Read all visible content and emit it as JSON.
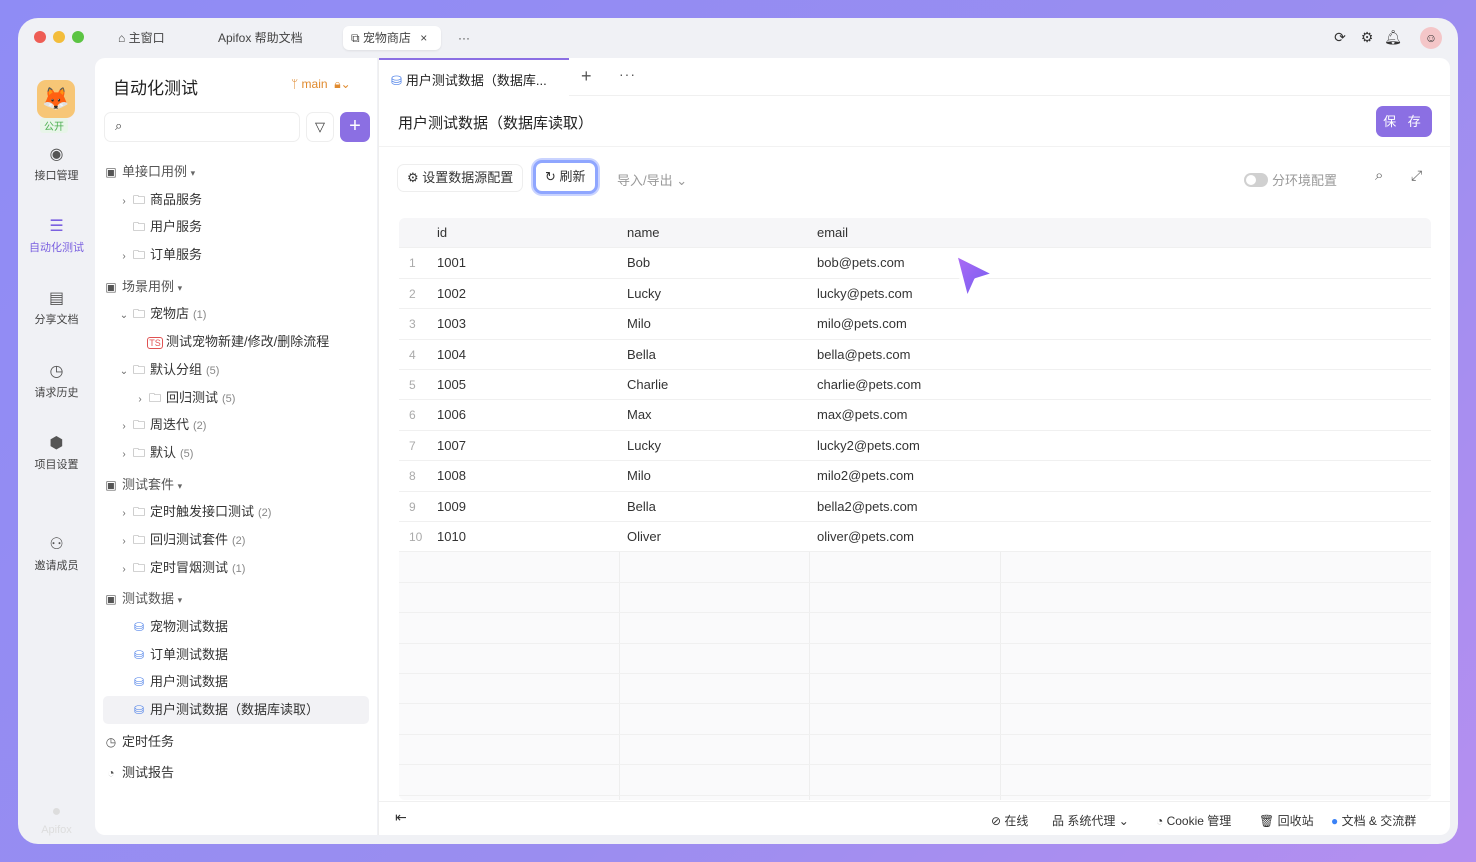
{
  "titlebar": {
    "tabs": [
      {
        "label": "主窗口",
        "icon": "home-icon"
      },
      {
        "label": "Apifox 帮助文档"
      },
      {
        "label": "宠物商店",
        "icon": "external-icon",
        "close": "×"
      }
    ],
    "more": "···"
  },
  "rail": {
    "badge": "公开",
    "items": [
      {
        "label": "接口管理"
      },
      {
        "label": "自动化测试"
      },
      {
        "label": "分享文档"
      },
      {
        "label": "请求历史"
      },
      {
        "label": "项目设置"
      },
      {
        "label": "邀请成员"
      }
    ],
    "brand": "Apifox"
  },
  "sidebar": {
    "title": "自动化测试",
    "branch": "main",
    "add": "+",
    "tree": [
      {
        "label": "单接口用例",
        "level": 0,
        "type": "section",
        "arrow": "▾"
      },
      {
        "label": "商品服务",
        "level": 1,
        "type": "folder",
        "arrow": "›"
      },
      {
        "label": "用户服务",
        "level": 1,
        "type": "folder"
      },
      {
        "label": "订单服务",
        "level": 1,
        "type": "folder",
        "arrow": "›"
      },
      {
        "label": "场景用例",
        "level": 0,
        "type": "section",
        "arrow": "▾"
      },
      {
        "label": "宠物店",
        "count": "(1)",
        "level": 1,
        "type": "folder",
        "arrow": "⌄"
      },
      {
        "label": "测试宠物新建/修改/删除流程",
        "level": 2,
        "type": "ts"
      },
      {
        "label": "默认分组",
        "count": "(5)",
        "level": 1,
        "type": "folder",
        "arrow": "⌄"
      },
      {
        "label": "回归测试",
        "count": "(5)",
        "level": 2,
        "type": "folder",
        "arrow": "›"
      },
      {
        "label": "周迭代",
        "count": "(2)",
        "level": 1,
        "type": "folder",
        "arrow": "›"
      },
      {
        "label": "默认",
        "count": "(5)",
        "level": 1,
        "type": "folder",
        "arrow": "›"
      },
      {
        "label": "测试套件",
        "level": 0,
        "type": "section",
        "arrow": "▾"
      },
      {
        "label": "定时触发接口测试",
        "count": "(2)",
        "level": 1,
        "type": "folder",
        "arrow": "›"
      },
      {
        "label": "回归测试套件",
        "count": "(2)",
        "level": 1,
        "type": "folder",
        "arrow": "›"
      },
      {
        "label": "定时冒烟测试",
        "count": "(1)",
        "level": 1,
        "type": "folder",
        "arrow": "›"
      },
      {
        "label": "测试数据",
        "level": 0,
        "type": "section",
        "arrow": "▾"
      },
      {
        "label": "宠物测试数据",
        "level": 1,
        "type": "db"
      },
      {
        "label": "订单测试数据",
        "level": 1,
        "type": "db"
      },
      {
        "label": "用户测试数据",
        "level": 1,
        "type": "db"
      },
      {
        "label": "用户测试数据（数据库读取）",
        "level": 1,
        "type": "db",
        "selected": true
      },
      {
        "label": "定时任务",
        "level": 0,
        "type": "clock"
      },
      {
        "label": "测试报告",
        "level": 0,
        "type": "report"
      }
    ]
  },
  "main": {
    "tab": "用户测试数据（数据库...",
    "tab_add": "+",
    "tab_more": "···",
    "title": "用户测试数据（数据库读取）",
    "save": "保 存",
    "toolbar": {
      "datasource": "设置数据源配置",
      "refresh": "刷新",
      "import_export": "导入/导出",
      "env_toggle": "分环境配置",
      "env_toggle_on": false
    },
    "table": {
      "columns": [
        "id",
        "name",
        "email"
      ],
      "rows": [
        [
          "1",
          "1001",
          "Bob",
          "bob@pets.com"
        ],
        [
          "2",
          "1002",
          "Lucky",
          "lucky@pets.com"
        ],
        [
          "3",
          "1003",
          "Milo",
          "milo@pets.com"
        ],
        [
          "4",
          "1004",
          "Bella",
          "bella@pets.com"
        ],
        [
          "5",
          "1005",
          "Charlie",
          "charlie@pets.com"
        ],
        [
          "6",
          "1006",
          "Max",
          "max@pets.com"
        ],
        [
          "7",
          "1007",
          "Lucky",
          "lucky2@pets.com"
        ],
        [
          "8",
          "1008",
          "Milo",
          "milo2@pets.com"
        ],
        [
          "9",
          "1009",
          "Bella",
          "bella2@pets.com"
        ],
        [
          "10",
          "1010",
          "Oliver",
          "oliver@pets.com"
        ]
      ]
    }
  },
  "footer": {
    "collapse": "⇤",
    "online": "在线",
    "proxy": "系统代理",
    "cookie": "Cookie 管理",
    "trash": "回收站",
    "docs": "文档 & 交流群"
  },
  "colors": {
    "accent": "#8b6fe3",
    "background": "#9a8df0"
  }
}
